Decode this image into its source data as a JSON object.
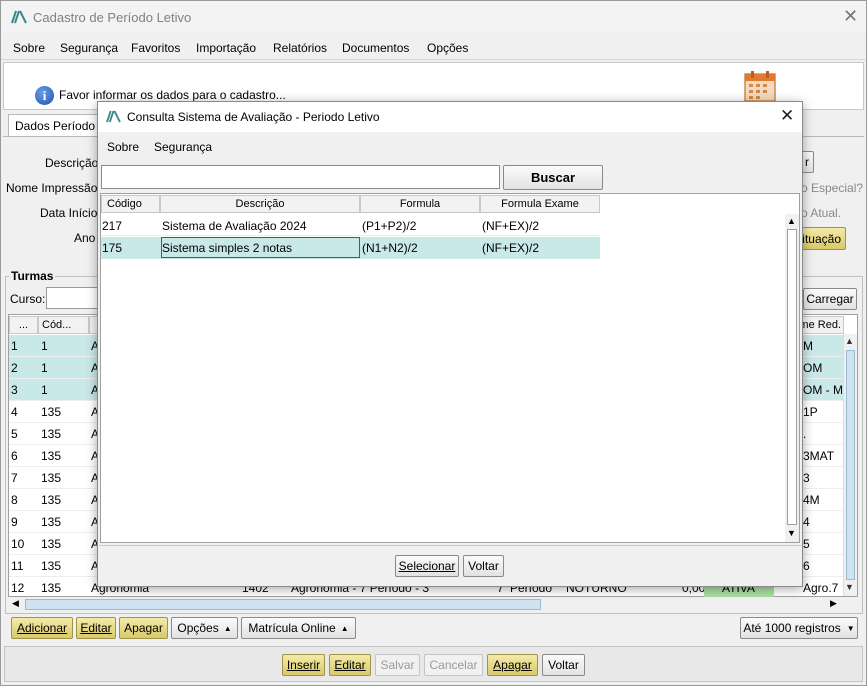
{
  "main_window": {
    "title": "Cadastro de Período Letivo",
    "menu": [
      "Sobre",
      "Segurança",
      "Favoritos",
      "Importação",
      "Relatórios",
      "Documentos",
      "Opções"
    ],
    "info_text": "Favor informar os dados para o cadastro...",
    "tab_label": "Dados Período l",
    "form_labels": [
      "Descrição",
      "Nome Impressão",
      "Data Início",
      "Ano"
    ],
    "right_texts": [
      "r",
      "o Especial?",
      "o Atual.",
      "ituação"
    ],
    "turmas": {
      "group_label": "Turmas",
      "curso_label": "Curso:",
      "carregar_label": "Carregar",
      "columns": [
        "...",
        "Cód...",
        "",
        "me Red."
      ],
      "rows": [
        {
          "n": "1",
          "cod": "1",
          "a": "A",
          "right": "M"
        },
        {
          "n": "2",
          "cod": "1",
          "a": "A",
          "right": "OM"
        },
        {
          "n": "3",
          "cod": "1",
          "a": "A",
          "right": "OM - M"
        },
        {
          "n": "4",
          "cod": "135",
          "a": "A",
          "right": "1P"
        },
        {
          "n": "5",
          "cod": "135",
          "a": "A",
          "right": "."
        },
        {
          "n": "6",
          "cod": "135",
          "a": "A",
          "right": "3MAT"
        },
        {
          "n": "7",
          "cod": "135",
          "a": "A",
          "right": "3"
        },
        {
          "n": "8",
          "cod": "135",
          "a": "A",
          "right": "4M"
        },
        {
          "n": "9",
          "cod": "135",
          "a": "A",
          "right": "4"
        },
        {
          "n": "10",
          "cod": "135",
          "a": "A",
          "right": "5"
        },
        {
          "n": "11",
          "cod": "135",
          "a": "A",
          "right": "6"
        }
      ],
      "last_row": {
        "n": "12",
        "cod": "135",
        "curso": "Agronomia",
        "num": "1402",
        "desc": "Agronomia - 7 Período - 3",
        "p": "7",
        "periodo": "Período",
        "turno": "NOTURNO",
        "valor": "0,00",
        "status": "ATIVA",
        "right": "Agro.7"
      }
    },
    "bottom_buttons": [
      "Adicionar",
      "Editar",
      "Apagar",
      "Opções",
      "Matrícula Online"
    ],
    "records_select": "Até 1000 registros",
    "footer_buttons": [
      "Inserir",
      "Editar",
      "Salvar",
      "Cancelar",
      "Apagar",
      "Voltar"
    ]
  },
  "dialog": {
    "title": "Consulta Sistema de Avaliação - Periodo Letivo",
    "menu": [
      "Sobre",
      "Segurança"
    ],
    "search_value": "",
    "buscar_label": "Buscar",
    "columns": [
      "Código",
      "Descrição",
      "Formula",
      "Formula Exame"
    ],
    "rows": [
      {
        "codigo": "217",
        "descricao": "Sistema de Avaliação 2024",
        "formula": "(P1+P2)/2",
        "exame": "(NF+EX)/2"
      },
      {
        "codigo": "175",
        "descricao": "Sistema simples 2 notas",
        "formula": "(N1+N2)/2",
        "exame": "(NF+EX)/2"
      }
    ],
    "selecionar_label": "Selecionar",
    "voltar_label": "Voltar"
  }
}
